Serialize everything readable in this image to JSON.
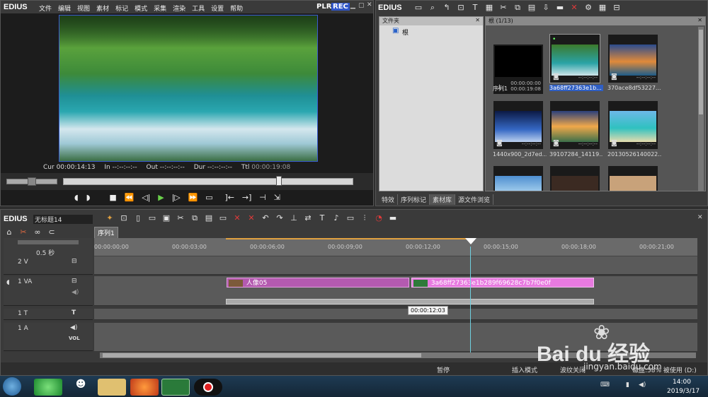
{
  "player": {
    "logo": "EDIUS",
    "menu": [
      "文件",
      "编辑",
      "视图",
      "素材",
      "标记",
      "模式",
      "采集",
      "渲染",
      "工具",
      "设置",
      "帮助"
    ],
    "plr": "PLR",
    "rec": "REC",
    "cur_label": "Cur",
    "cur_value": "00:00:14:13",
    "in_label": "In",
    "in_value": "--:--:--:--",
    "out_label": "Out",
    "out_value": "--:--:--:--",
    "dur_label": "Dur",
    "dur_value": "--:--:--:--",
    "ttl_label": "Ttl",
    "ttl_value": "00:00:19:08"
  },
  "bin": {
    "logo": "EDIUS",
    "folder_title": "文件夹",
    "root_label": "根",
    "path": "根 (1/13)",
    "items": [
      {
        "caption": "序列1",
        "tc_in": "00:00:00:00",
        "tc_out": "00:00:19:08"
      },
      {
        "caption": "3a68ff27363e1b...",
        "tc": "--:--:--:--"
      },
      {
        "caption": "370ace8df53227...",
        "tc": "--:--:--:--"
      },
      {
        "caption": "1440x900_2d7ed...",
        "tc": "--:--:--:--"
      },
      {
        "caption": "39107284_14119...",
        "tc": "--:--:--:--"
      },
      {
        "caption": "20130526140022...",
        "tc": "--:--:--:--"
      }
    ],
    "tabs": [
      "特效",
      "序列标记",
      "素材库",
      "源文件浏览"
    ]
  },
  "timeline": {
    "logo": "EDIUS",
    "project": "无标题14",
    "sequence_tab": "序列1",
    "zoom": "0.5 秒",
    "ruler": [
      "00:00:00;00",
      "00:00:03;00",
      "00:00:06;00",
      "00:00:09;00",
      "00:00:12;00",
      "00:00:15;00",
      "00:00:18;00",
      "00:00:21;00"
    ],
    "tracks": {
      "v2": "2 V",
      "va1": "1 VA",
      "t1": "1 T",
      "a1": "1 A",
      "vol": "VOL"
    },
    "clips": [
      "人像05",
      "3a68ff27363e1b289f69628c7b7f0e0f"
    ],
    "tooltip": "00:00:12:03"
  },
  "status": {
    "pause": "暂停",
    "insert_mode": "插入模式",
    "ripple": "波纹关闭",
    "disk": "磁盘:58% 被使用 (D:)"
  },
  "taskbar": {
    "time": "14:00",
    "date": "2019/3/17"
  },
  "watermark": {
    "brand": "Bai du 经验",
    "url": "jingyan.baidu.com"
  }
}
